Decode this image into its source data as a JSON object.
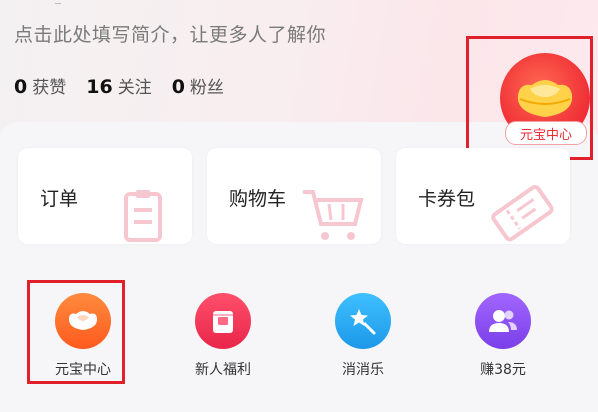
{
  "profile": {
    "bio_placeholder": "点击此处填写简介，让更多人了解你",
    "stats": [
      {
        "value": "0",
        "label": "获赞"
      },
      {
        "value": "16",
        "label": "关注"
      },
      {
        "value": "0",
        "label": "粉丝"
      }
    ]
  },
  "ingot_badge": {
    "label": "元宝中心"
  },
  "quick_cards": [
    {
      "label": "订单",
      "icon": "order-icon"
    },
    {
      "label": "购物车",
      "icon": "cart-icon"
    },
    {
      "label": "卡券包",
      "icon": "coupon-icon"
    }
  ],
  "apps": [
    {
      "label": "元宝中心",
      "icon": "ingot-icon",
      "color": "#ff6a2c"
    },
    {
      "label": "新人福利",
      "icon": "gift-icon",
      "color": "#f23b5a"
    },
    {
      "label": "消消乐",
      "icon": "game-icon",
      "color": "#27a8f3"
    },
    {
      "label": "赚38元",
      "icon": "users-icon",
      "color": "#8a4bf1"
    }
  ],
  "highlight_color": "#e0202a"
}
